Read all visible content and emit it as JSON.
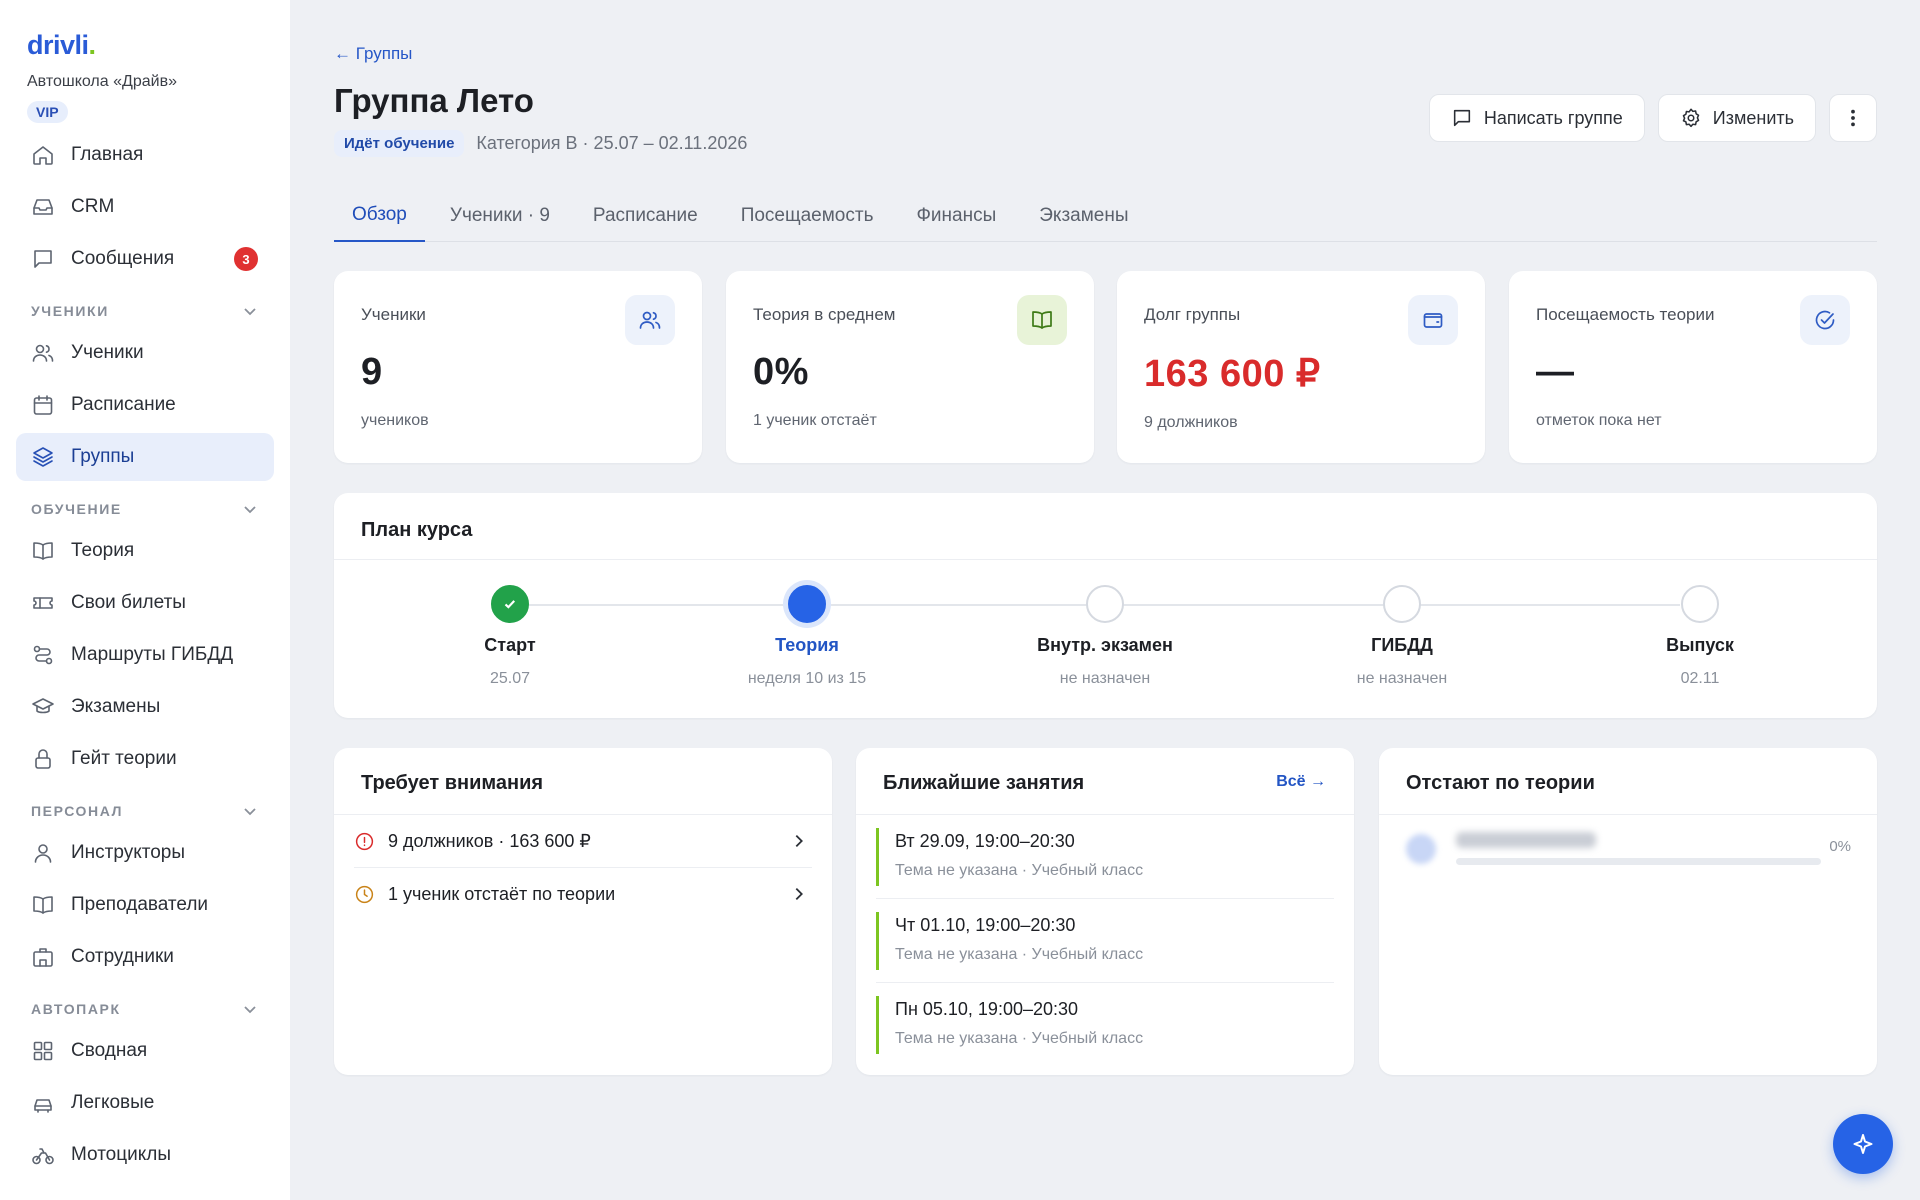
{
  "brand": {
    "logo": "drivli",
    "logo_dot": ".",
    "school": "Автошкола «Драйв»",
    "tier": "VIP"
  },
  "sidebar": {
    "top": [
      {
        "label": "Главная",
        "icon": "home-icon"
      },
      {
        "label": "CRM",
        "icon": "inbox-icon"
      },
      {
        "label": "Сообщения",
        "icon": "message-icon",
        "badge": "3"
      }
    ],
    "students_section": "УЧЕНИКИ",
    "students": [
      {
        "label": "Ученики",
        "icon": "users-icon"
      },
      {
        "label": "Расписание",
        "icon": "calendar-icon"
      },
      {
        "label": "Группы",
        "icon": "layers-icon",
        "active": true
      }
    ],
    "learning_section": "ОБУЧЕНИЕ",
    "learning": [
      {
        "label": "Теория",
        "icon": "book-icon"
      },
      {
        "label": "Свои билеты",
        "icon": "ticket-icon"
      },
      {
        "label": "Маршруты ГИБДД",
        "icon": "route-icon"
      },
      {
        "label": "Экзамены",
        "icon": "graduation-icon"
      },
      {
        "label": "Гейт теории",
        "icon": "lock-icon"
      }
    ],
    "staff_section": "ПЕРСОНАЛ",
    "staff": [
      {
        "label": "Инструкторы",
        "icon": "person-icon"
      },
      {
        "label": "Преподаватели",
        "icon": "book-open-icon"
      },
      {
        "label": "Сотрудники",
        "icon": "building-icon"
      }
    ],
    "fleet_section": "АВТОПАРК",
    "fleet": [
      {
        "label": "Сводная",
        "icon": "grid-icon"
      },
      {
        "label": "Легковые",
        "icon": "car-icon"
      },
      {
        "label": "Мотоциклы",
        "icon": "motorcycle-icon"
      }
    ]
  },
  "header": {
    "back": "← Группы",
    "title": "Группа Лето",
    "status": "Идёт обучение",
    "meta": "Категория B · 25.07 – 02.11.2026",
    "message_btn": "Написать группе",
    "edit_btn": "Изменить"
  },
  "tabs": [
    "Обзор",
    "Ученики · 9",
    "Расписание",
    "Посещаемость",
    "Финансы",
    "Экзамены"
  ],
  "active_tab": 0,
  "stats": [
    {
      "label": "Ученики",
      "value": "9",
      "sub": "учеников",
      "icon": "users-icon"
    },
    {
      "label": "Теория в среднем",
      "value": "0%",
      "sub": "1 ученик отстаёт",
      "icon": "book-icon"
    },
    {
      "label": "Долг группы",
      "value": "163 600 ₽",
      "sub": "9 должников",
      "icon": "wallet-icon",
      "value_color": "#d92b2b"
    },
    {
      "label": "Посещаемость теории",
      "value": "—",
      "sub": "отметок пока нет",
      "icon": "check-circle-icon"
    }
  ],
  "plan": {
    "title": "План курса",
    "steps": [
      {
        "name": "Старт",
        "sub": "25.07",
        "state": "done"
      },
      {
        "name": "Теория",
        "sub": "неделя 10 из 15",
        "state": "current"
      },
      {
        "name": "Внутр. экзамен",
        "sub": "не назначен",
        "state": "pending"
      },
      {
        "name": "ГИБДД",
        "sub": "не назначен",
        "state": "pending"
      },
      {
        "name": "Выпуск",
        "sub": "02.11",
        "state": "pending"
      }
    ]
  },
  "attention": {
    "title": "Требует внимания",
    "items": [
      {
        "text": "9 должников · 163 600 ₽",
        "icon": "alert-circle-icon",
        "color": "#d92b2b"
      },
      {
        "text": "1 ученик отстаёт по теории",
        "icon": "clock-icon",
        "color": "#c98318"
      }
    ]
  },
  "lessons": {
    "title": "Ближайшие занятия",
    "see_all": "Всё →",
    "items": [
      {
        "time": "Вт 29.09, 19:00–20:30",
        "sub": "Тема не указана · Учебный класс"
      },
      {
        "time": "Чт 01.10, 19:00–20:30",
        "sub": "Тема не указана · Учебный класс"
      },
      {
        "time": "Пн 05.10, 19:00–20:30",
        "sub": "Тема не указана · Учебный класс"
      }
    ]
  },
  "lagging": {
    "title": "Отстают по теории",
    "items": [
      {
        "percent": "0%"
      }
    ]
  },
  "colors": {
    "accent": "#2663e6",
    "danger": "#d92b2b",
    "success": "#22a24a",
    "lime": "#7cc520"
  }
}
